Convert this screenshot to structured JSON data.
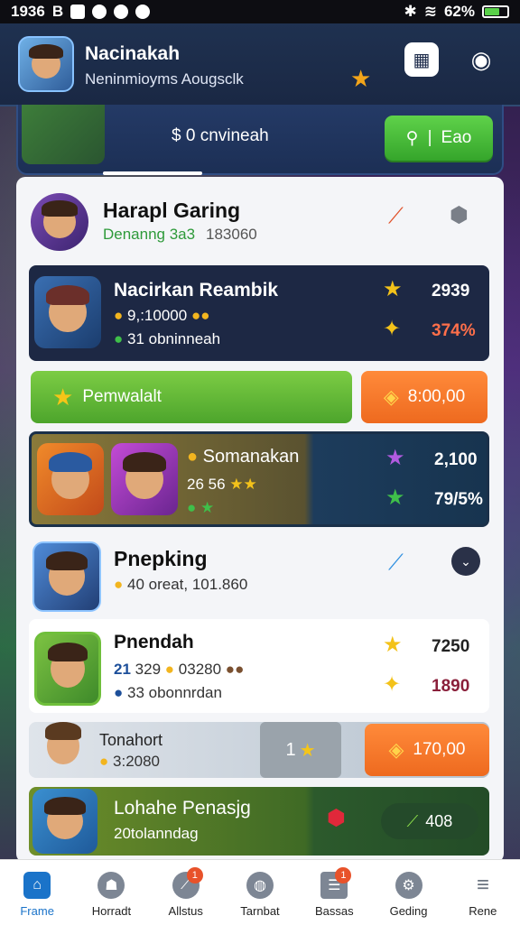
{
  "status_bar": {
    "time": "1936",
    "letter": "B",
    "battery": "62%"
  },
  "header": {
    "title": "Nacinakah",
    "subtitle": "Neninmioyms Aougsclk"
  },
  "promo": {
    "text": "$ 0 cnvineah",
    "button_label": "Eao"
  },
  "rows": {
    "profile": {
      "name": "Harapl Garing",
      "sub_green": "Denanng 3a3",
      "sub_grey": "183060"
    },
    "featured": {
      "name": "Nacirkan Reambik",
      "line1": "9,:10000",
      "line2": "31 obninneah",
      "value1": "2939",
      "value2": "374%"
    },
    "action_bar": {
      "left_label": "Pemwalalt",
      "right_label": "8:00,00"
    },
    "team": {
      "name": "Somanakan",
      "line1": "26 56",
      "value1": "2,100",
      "value2": "79/5%"
    },
    "pnepking": {
      "name": "Pnepking",
      "sub": "40 oreat, 101.860"
    },
    "pnendah": {
      "name": "Pnendah",
      "line1_num": "21",
      "line1_val": "329",
      "line1_val2": "03280",
      "line2": "33 obonnrdan",
      "value1": "7250",
      "value2": "1890"
    },
    "tonahort": {
      "name": "Tonahort",
      "sub": "3:2080",
      "mid_value": "1",
      "right_value": "170,00"
    },
    "lohahe": {
      "name": "Lohahe Penasjg",
      "sub": "20tolanndag",
      "value": "408"
    }
  },
  "bottom_nav": {
    "items": [
      {
        "label": "Frame",
        "icon": "home-icon",
        "badge": ""
      },
      {
        "label": "Horradt",
        "icon": "robot-icon",
        "badge": ""
      },
      {
        "label": "Allstus",
        "icon": "compass-icon",
        "badge": "1"
      },
      {
        "label": "Tarnbat",
        "icon": "shield-icon",
        "badge": ""
      },
      {
        "label": "Bassas",
        "icon": "list-icon",
        "badge": "1"
      },
      {
        "label": "Geding",
        "icon": "gear-icon",
        "badge": ""
      },
      {
        "label": "Rene",
        "icon": "menu-icon",
        "badge": ""
      }
    ]
  }
}
